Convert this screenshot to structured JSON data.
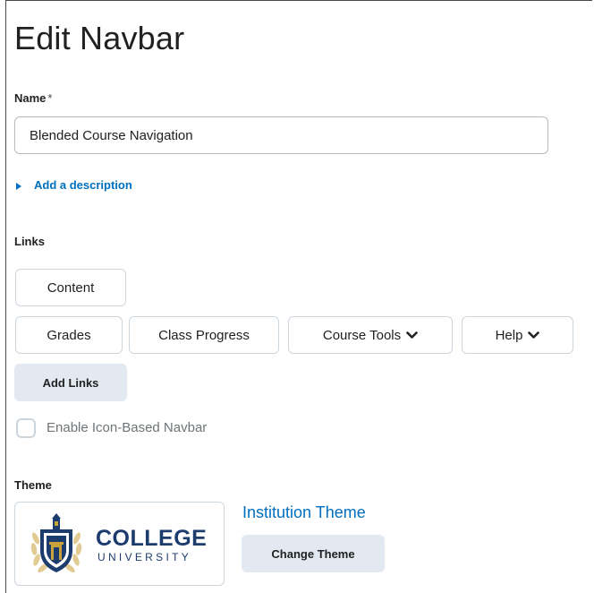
{
  "page": {
    "title": "Edit Navbar"
  },
  "name_field": {
    "label": "Name",
    "required_marker": "*",
    "value": "Blended Course Navigation"
  },
  "description": {
    "link_label": "Add a description"
  },
  "links": {
    "label": "Links",
    "items": [
      {
        "label": "Content"
      },
      {
        "label": "Grades"
      },
      {
        "label": "Class Progress"
      },
      {
        "label": "Course Tools",
        "has_dropdown": true
      },
      {
        "label": "Help",
        "has_dropdown": true
      }
    ],
    "add_button_label": "Add Links"
  },
  "icon_navbar": {
    "label": "Enable Icon-Based Navbar",
    "checked": false
  },
  "theme": {
    "label": "Theme",
    "logo": {
      "line1": "COLLEGE",
      "line2": "UNIVERSITY"
    },
    "name": "Institution Theme",
    "change_button_label": "Change Theme"
  },
  "colors": {
    "link": "#006fbf",
    "button_gray": "#e3e9f1",
    "logo_navy": "#1d3c6e",
    "logo_gold": "#c9a23a"
  }
}
